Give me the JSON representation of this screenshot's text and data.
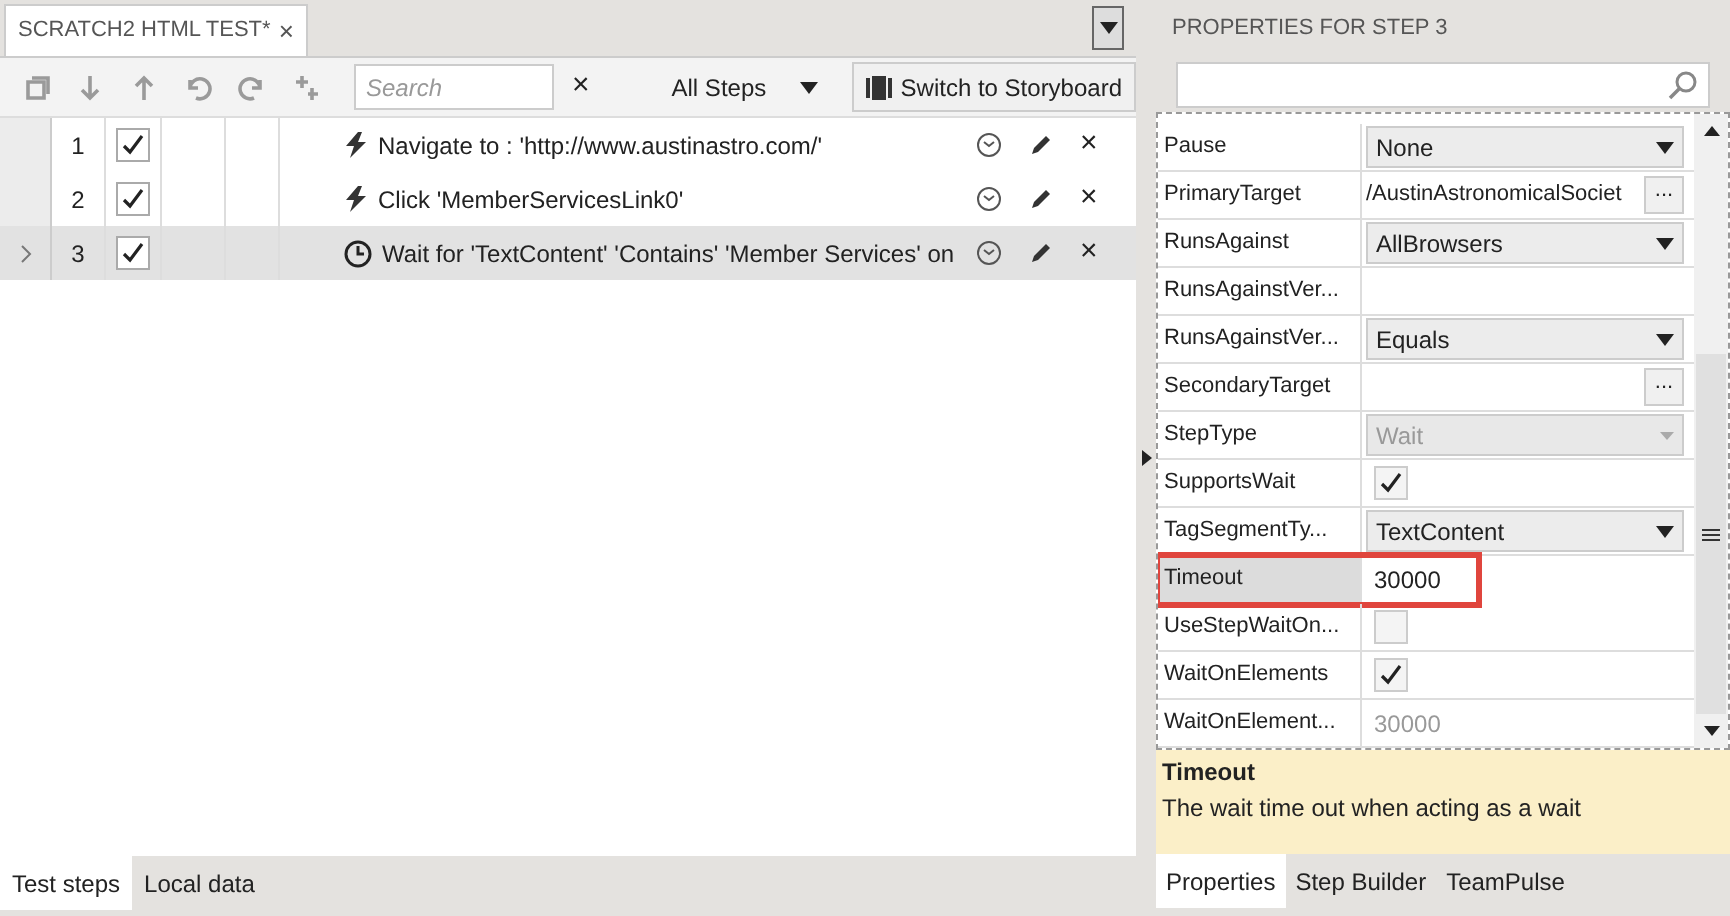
{
  "document_tab": {
    "title": "SCRATCH2 HTML TEST*",
    "close": "×"
  },
  "toolbar": {
    "search": {
      "placeholder": "Search"
    },
    "clear": "×",
    "filter": "All Steps",
    "storyboard_button": "Switch to Storyboard"
  },
  "steps": [
    {
      "number": "1",
      "enabled": true,
      "selected": false,
      "kind": "action",
      "text": "Navigate to : 'http://www.austinastro.com/'",
      "delete": "×"
    },
    {
      "number": "2",
      "enabled": true,
      "selected": false,
      "kind": "action",
      "text": "Click 'MemberServicesLink0'",
      "delete": "×"
    },
    {
      "number": "3",
      "enabled": true,
      "selected": true,
      "kind": "wait",
      "text": "Wait for 'TextContent' 'Contains' 'Member Services' on",
      "delete": "×"
    }
  ],
  "bottom_tabs": [
    {
      "label": "Test steps",
      "selected": true
    },
    {
      "label": "Local data",
      "selected": false
    }
  ],
  "properties": {
    "title": "PROPERTIES FOR STEP 3",
    "rows": [
      {
        "name": "Pause",
        "kind": "dropdown",
        "value": "None",
        "selected": false,
        "disabled": false
      },
      {
        "name": "PrimaryTarget",
        "kind": "browse",
        "value": "/AustinAstronomicalSociet",
        "button": "...",
        "selected": false
      },
      {
        "name": "RunsAgainst",
        "kind": "dropdown",
        "value": "AllBrowsers",
        "selected": false,
        "disabled": false
      },
      {
        "name": "RunsAgainstVer...",
        "kind": "text",
        "selected": false
      },
      {
        "name": "RunsAgainstVer...",
        "kind": "dropdown",
        "value": "Equals",
        "selected": false,
        "disabled": false
      },
      {
        "name": "SecondaryTarget",
        "kind": "browse",
        "button": "...",
        "selected": false
      },
      {
        "name": "StepType",
        "kind": "dropdown",
        "value": "Wait",
        "selected": false,
        "disabled": true
      },
      {
        "name": "SupportsWait",
        "kind": "checkbox",
        "checked": true,
        "selected": false
      },
      {
        "name": "TagSegmentTy...",
        "kind": "dropdown",
        "value": "TextContent",
        "selected": false,
        "disabled": false
      },
      {
        "name": "Timeout",
        "kind": "text",
        "value": "30000",
        "selected": true,
        "disabled": false
      },
      {
        "name": "UseStepWaitOn...",
        "kind": "checkbox",
        "checked": false,
        "selected": false
      },
      {
        "name": "WaitOnElements",
        "kind": "checkbox",
        "checked": true,
        "selected": false
      },
      {
        "name": "WaitOnElement...",
        "kind": "text",
        "value": "30000",
        "selected": false,
        "disabled": true
      }
    ],
    "description": {
      "title": "Timeout",
      "text": "The wait time out when acting as a wait"
    },
    "tabs": [
      {
        "label": "Properties",
        "selected": true
      },
      {
        "label": "Step Builder",
        "selected": false
      },
      {
        "label": "TeamPulse",
        "selected": false
      }
    ]
  }
}
